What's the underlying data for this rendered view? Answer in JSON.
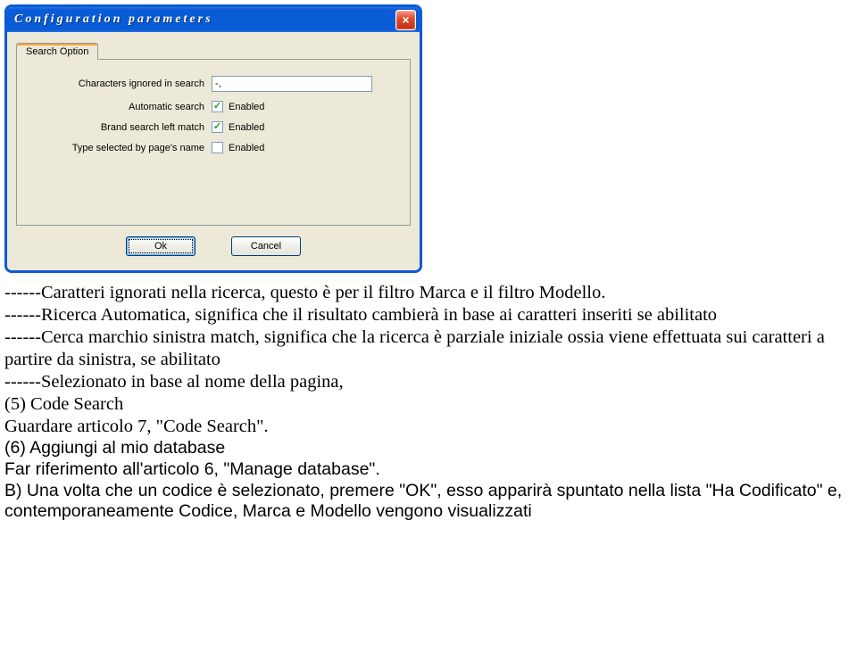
{
  "dialog": {
    "title": "Configuration parameters",
    "tab": "Search Option",
    "fields": {
      "chars_ignored_label": "Characters ignored in search",
      "chars_ignored_value": "-,",
      "auto_search_label": "Automatic search",
      "auto_search_enabled": "Enabled",
      "brand_left_label": "Brand search left match",
      "brand_left_enabled": "Enabled",
      "type_page_label": "Type selected by page's name",
      "type_page_enabled": "Enabled"
    },
    "buttons": {
      "ok": "Ok",
      "cancel": "Cancel"
    },
    "close_icon": "×"
  },
  "doc": {
    "l1": "------Caratteri ignorati nella ricerca, questo è per il filtro Marca e il filtro Modello.",
    "l2": "------Ricerca Automatica, significa che il risultato cambierà in base ai caratteri inseriti se abilitato",
    "l3": "------Cerca marchio sinistra match, significa che la ricerca è parziale iniziale ossia viene effettuata sui caratteri a partire da sinistra, se abilitato",
    "l4": "------Selezionato in base al nome della pagina,",
    "l5": "(5) Code Search",
    "l6": "Guardare articolo 7, \"Code Search\".",
    "l7": "(6) Aggiungi al mio database",
    "l8": "Far riferimento all'articolo 6, \"Manage database\".",
    "l9": "B) Una volta che un codice è selezionato, premere \"OK\", esso apparirà spuntato nella lista \"Ha Codificato\" e, contemporaneamente Codice, Marca e Modello vengono visualizzati"
  }
}
